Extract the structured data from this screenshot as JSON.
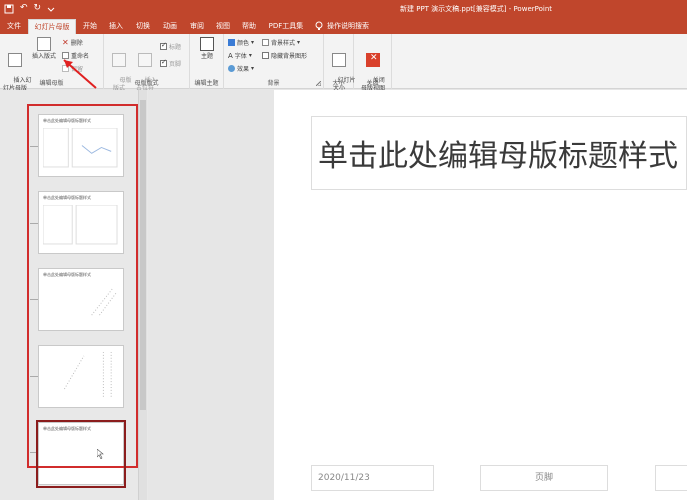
{
  "window": {
    "title": "新建 PPT 演示文稿.ppt[兼容模式] - PowerPoint"
  },
  "quick_access": {
    "undo": "↶",
    "redo": "↻",
    "save_icon": "save-icon"
  },
  "tabs": [
    {
      "label": "文件"
    },
    {
      "label": "幻灯片母版"
    },
    {
      "label": "开始"
    },
    {
      "label": "插入"
    },
    {
      "label": "切换"
    },
    {
      "label": "动画"
    },
    {
      "label": "审阅"
    },
    {
      "label": "视图"
    },
    {
      "label": "帮助"
    },
    {
      "label": "PDF工具集"
    }
  ],
  "tell_me": "操作说明搜索",
  "ribbon": {
    "edit_master": {
      "label": "编辑母版",
      "insert_slide_master": "插入幻\n灯片母版",
      "insert_layout": "插入版式",
      "delete": "删除",
      "rename": "重命名",
      "preserve": "保留"
    },
    "master_layout": {
      "label": "母版版式",
      "master_layout_btn": "母版\n版式",
      "insert_placeholder": "插入\n占位符",
      "title_chk": "标题",
      "footer_chk": "页脚"
    },
    "edit_theme": {
      "label": "编辑主题",
      "theme": "主题"
    },
    "background": {
      "label": "背景",
      "colors": "颜色",
      "fonts": "字体",
      "effects": "效果",
      "bg_styles": "背景样式",
      "hide_bg": "隐藏背景图形"
    },
    "size": {
      "label": "大小",
      "slide_size": "幻灯片\n大小"
    },
    "close": {
      "label": "关闭",
      "close_master": "关闭\n母版视图"
    }
  },
  "thumbnails": [
    {
      "title": "单击此处编辑母版标题样式"
    },
    {
      "title": "单击此处编辑母版标题样式"
    },
    {
      "title": "单击此处编辑母版标题样式"
    },
    {
      "title": "单击此处编辑母版标题样式"
    },
    {
      "title": "单击此处编辑母版标题样式"
    }
  ],
  "slide": {
    "title_placeholder": "单击此处编辑母版标题样式",
    "date": "2020/11/23",
    "footer": "页脚"
  }
}
